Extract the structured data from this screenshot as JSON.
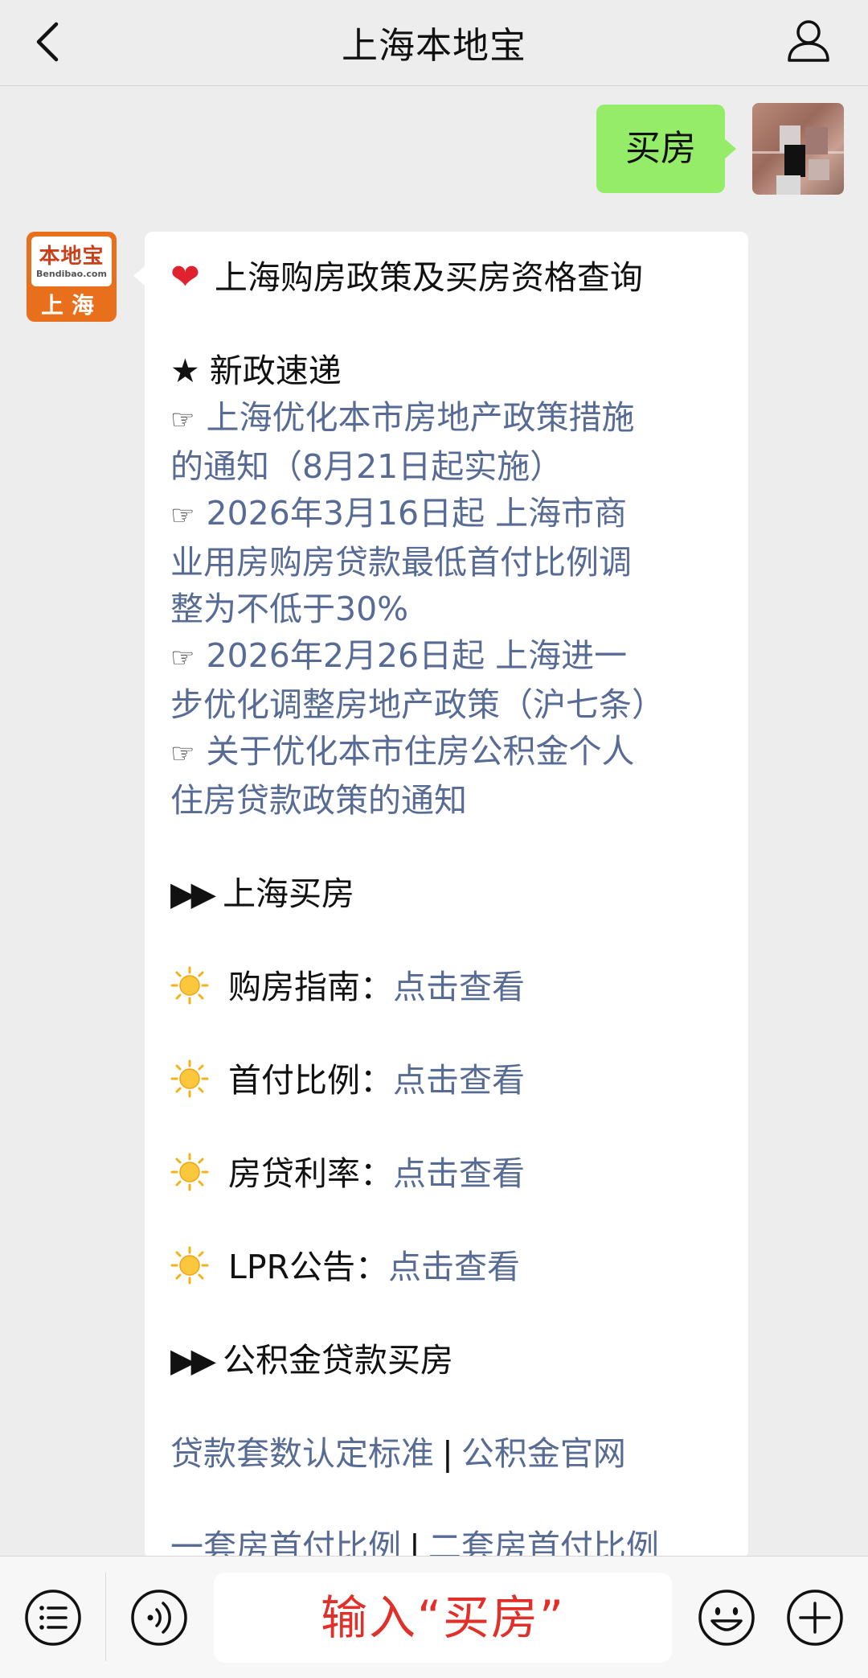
{
  "header": {
    "title": "上海本地宝"
  },
  "sent_message": {
    "text": "买房"
  },
  "bot": {
    "logo_main": "本地宝",
    "logo_sub": "Bendibao.com",
    "logo_city": "上海"
  },
  "reply": {
    "title": "上海购房政策及买房资格查询",
    "news_heading": "新政速递",
    "news_items": [
      [
        "上海优化本市房地产政策措施",
        "的通知（8月21日起实施）"
      ],
      [
        "2026年3月16日起 上海市商",
        "业用房购房贷款最低首付比例调",
        "整为不低于30%"
      ],
      [
        "2026年2月26日起 上海进一",
        "步优化调整房地产政策（沪七条）"
      ],
      [
        "关于优化本市住房公积金个人",
        "住房贷款政策的通知"
      ]
    ],
    "section1_heading": "上海买房",
    "guides": [
      {
        "label": "购房指南：",
        "link": "点击查看"
      },
      {
        "label": "首付比例：",
        "link": "点击查看"
      },
      {
        "label": "房贷利率：",
        "link": "点击查看"
      },
      {
        "label": "LPR公告：",
        "link": "点击查看"
      }
    ],
    "section2_heading": "公积金贷款买房",
    "link_row1": [
      "贷款套数认定标准",
      "公积金官网"
    ],
    "link_row2": [
      "一套房首付比例",
      "二套房首付比例"
    ],
    "separator": "|"
  },
  "input": {
    "placeholder": "输入“买房”"
  },
  "colors": {
    "background": "#ededed",
    "sent_bubble": "#95ec69",
    "link": "#576b95",
    "heart": "#e0222f",
    "input_hint": "#e0302a",
    "logo_orange": "#e8701c"
  },
  "icons": [
    "back-arrow-icon",
    "profile-icon",
    "heart-icon",
    "star-icon",
    "pointing-hand-icon",
    "play-triangle-icon",
    "sun-icon",
    "menu-list-icon",
    "voice-icon",
    "emoji-icon",
    "plus-icon"
  ]
}
